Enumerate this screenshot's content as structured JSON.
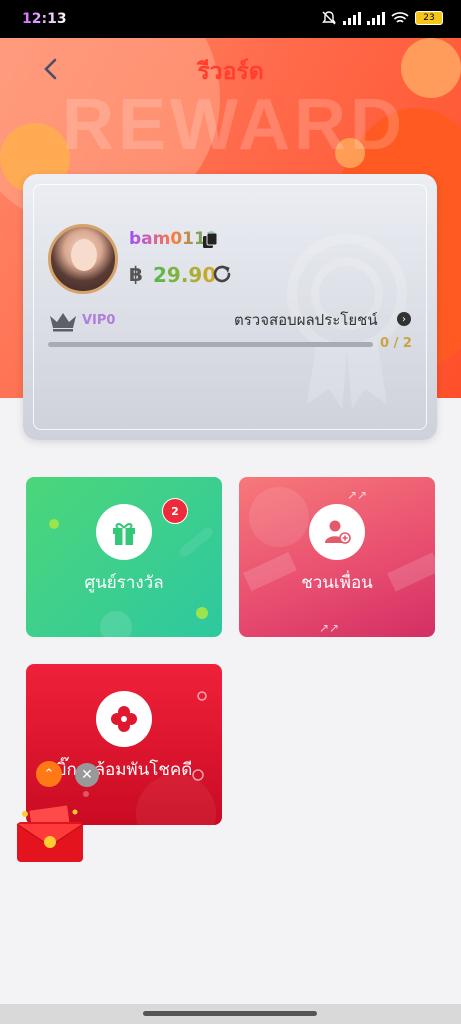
{
  "status_bar": {
    "time": "12:13",
    "battery": "23"
  },
  "header": {
    "title": "รีวอร์ด",
    "watermark": "REWARD"
  },
  "account": {
    "username": "bam0112",
    "currency_symbol": "฿",
    "balance": "29.90",
    "vip_level": "VIP0",
    "check_benefits_label": "ตรวจสอบผลประโยชน์",
    "progress_text": "0 / 2",
    "progress_fraction": 0
  },
  "tiles": {
    "reward_center": {
      "label": "ศูนย์รางวัล",
      "badge": "2"
    },
    "invite_friend": {
      "label": "ชวนเพื่อน"
    },
    "lucky_wheel": {
      "label": "บิ๊กวงล้อมพันโชคดี"
    }
  },
  "colors": {
    "accent": "#ff3e2e",
    "green_tile": "#3fd08a",
    "pink_tile": "#e84c6f",
    "red_tile": "#e0172f"
  }
}
